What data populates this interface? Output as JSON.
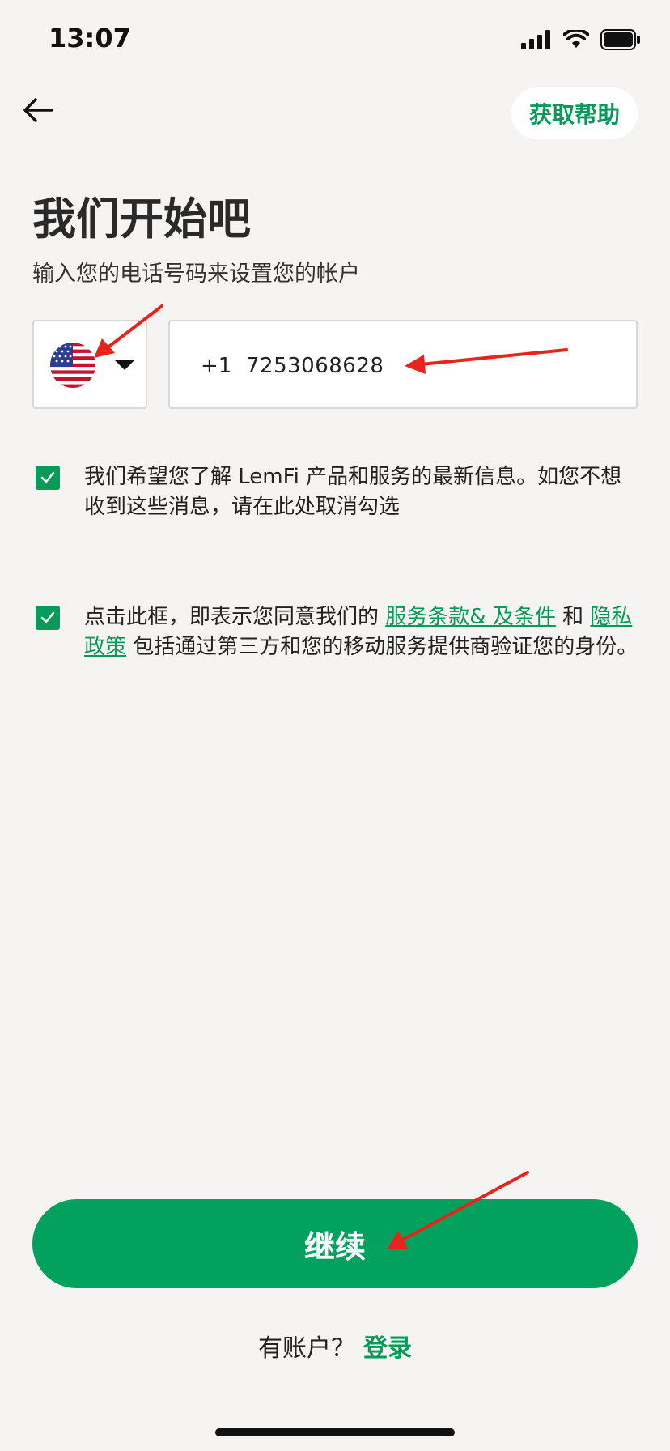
{
  "status_bar": {
    "time": "13:07"
  },
  "header": {
    "help_label": "获取帮助"
  },
  "page": {
    "title": "我们开始吧",
    "subtitle": "输入您的电话号码来设置您的帐户"
  },
  "phone": {
    "dial_code": "+1",
    "number": "7253068628"
  },
  "consents": {
    "marketing_text": "我们希望您了解 LemFi 产品和服务的最新信息。如您不想收到这些消息，请在此处取消勾选",
    "terms_prefix": "点击此框，即表示您同意我们的",
    "terms_link": "服务条款& 及条件",
    "terms_and": "和",
    "privacy_link": "隐私政策",
    "terms_suffix": "包括通过第三方和您的移动服务提供商验证您的身份。"
  },
  "actions": {
    "continue_label": "继续",
    "have_account": "有账户？",
    "login_label": "登录"
  },
  "colors": {
    "brand": "#02a25e",
    "annotation": "#e8231a"
  }
}
